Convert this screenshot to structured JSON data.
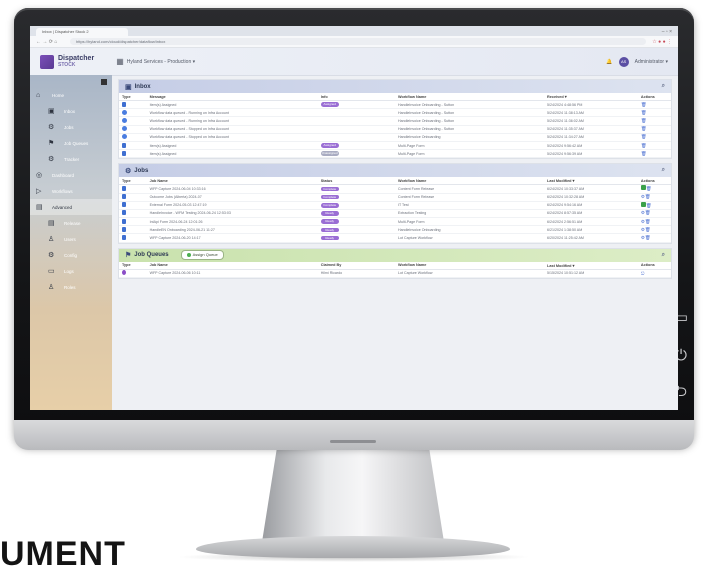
{
  "browser": {
    "tab_title": "Inbox | Dispatcher Stock 2",
    "url": "https://hyland.com/cloud/dispatcher/dataflow/inbox",
    "nav_icons": "← → ⟳ ⌂",
    "ext_icons": "☆ ● ● ⋮",
    "window_controls": "–  ▫  ×"
  },
  "header": {
    "logo_title": "Dispatcher",
    "logo_sub": "STOCK",
    "workspace": "Hyland Services - Production ▾",
    "avatar_initials": "AS",
    "user_name": "Administrator ▾",
    "notif_icon": "🔔"
  },
  "sidebar": {
    "items": [
      {
        "icon": "⌂",
        "label": "Home",
        "sub": false,
        "active": false
      },
      {
        "icon": "▣",
        "label": "Inbox",
        "sub": true,
        "active": false
      },
      {
        "icon": "⚙",
        "label": "Jobs",
        "sub": true,
        "active": false
      },
      {
        "icon": "⚑",
        "label": "Job Queues",
        "sub": true,
        "active": false
      },
      {
        "icon": "⚙",
        "label": "Tracker",
        "sub": true,
        "active": false
      },
      {
        "icon": "◎",
        "label": "Dashboard",
        "sub": false,
        "active": false
      },
      {
        "icon": "▷",
        "label": "Workflows",
        "sub": false,
        "active": false
      },
      {
        "icon": "▤",
        "label": "Advanced",
        "sub": false,
        "active": true
      },
      {
        "icon": "▤",
        "label": "Release",
        "sub": true,
        "active": false
      },
      {
        "icon": "♙",
        "label": "Users",
        "sub": true,
        "active": false
      },
      {
        "icon": "⚙",
        "label": "Config",
        "sub": true,
        "active": false
      },
      {
        "icon": "▭",
        "label": "Logs",
        "sub": true,
        "active": false
      },
      {
        "icon": "♙",
        "label": "Roles",
        "sub": true,
        "active": false
      }
    ]
  },
  "inbox": {
    "title": "Inbox",
    "columns": [
      "Type",
      "Message",
      "Info",
      "Workflow Name",
      "Received ▾",
      "Actions"
    ],
    "rows": [
      {
        "type": "doc",
        "message": "Item(s) Assigned",
        "info": "Assigned",
        "workflow": "HandleInvoice Onboarding - Sutton",
        "received": "5/24/2024 4:48:56 PM"
      },
      {
        "type": "flow",
        "message": "Workflow data queued - Running on Infra Account",
        "info": "",
        "workflow": "HandleInvoice Onboarding - Sutton",
        "received": "5/24/2024 11:38:13 AM"
      },
      {
        "type": "flow",
        "message": "Workflow data queued - Running on Infra Account",
        "info": "",
        "workflow": "HandleInvoice Onboarding - Sutton",
        "received": "5/24/2024 11:36:02 AM"
      },
      {
        "type": "flow",
        "message": "Workflow data queued - Stopped on Infra Account",
        "info": "",
        "workflow": "HandleInvoice Onboarding - Sutton",
        "received": "5/24/2024 11:35:37 AM"
      },
      {
        "type": "flow",
        "message": "Workflow data queued - Stopped on Infra Account",
        "info": "",
        "workflow": "HandleInvoice Onboarding",
        "received": "5/24/2024 11:34:27 AM"
      },
      {
        "type": "doc",
        "message": "Item(s) Assigned",
        "info": "Assigned",
        "workflow": "Multi-Page Form",
        "received": "5/24/2024 9:56:42 AM"
      },
      {
        "type": "doc",
        "message": "Item(s) Assigned",
        "info": "Unassigned",
        "workflow": "Multi-Page Form",
        "received": "5/24/2024 9:56:39 AM"
      }
    ]
  },
  "jobs": {
    "title": "Jobs",
    "columns": [
      "Type",
      "Job Name",
      "Status",
      "Workflow Name",
      "Last Modified ▾",
      "Actions"
    ],
    "rows": [
      {
        "name": "WFP Capture 2024-06-04 10:33:16",
        "status": "Complete",
        "workflow": "Content Form Release",
        "modified": "6/24/2024 10:33:37 AM"
      },
      {
        "name": "Outcome Jobs (Alberta) 2024-07",
        "status": "Complete",
        "workflow": "Content Form Release",
        "modified": "6/24/2024 10:32:28 AM"
      },
      {
        "name": "External Form 2024-05-03 12:47:19",
        "status": "Complete",
        "workflow": "IT Test",
        "modified": "6/24/2024 9:54:16 AM"
      },
      {
        "name": "HandleInvoice - WFM Testing 2024-06-24 12:53:03",
        "status": "Ready",
        "workflow": "Extraction Testing",
        "modified": "6/24/2024 8:57:35 AM"
      },
      {
        "name": "IntApi Form 2024-06-24 12:01:26",
        "status": "Ready",
        "workflow": "Multi-Page Form",
        "modified": "6/24/2024 2:56:51 AM"
      },
      {
        "name": "HandleEN Onboarding 2024-06-21 11:27",
        "status": "Ready",
        "workflow": "HandleInvoice Onboarding",
        "modified": "6/21/2024 1:38:50 AM"
      },
      {
        "name": "WFP Capture 2024-06-20 14:17",
        "status": "Ready",
        "workflow": "Lot Capture Workflow",
        "modified": "6/20/2024 11:25:42 AM"
      }
    ]
  },
  "queues": {
    "title": "Job Queues",
    "button": "Assign Queue",
    "columns": [
      "Type",
      "Job Name",
      "Claimed By",
      "Workflow Name",
      "Last Modified ▾",
      "Actions"
    ],
    "rows": [
      {
        "name": "WFP Capture 2024-06-06 10:11",
        "claimed": "Hilmi Ricardo",
        "workflow": "Lot Capture Workflow",
        "modified": "5/15/2024 10:51:12 AM"
      }
    ]
  },
  "frame": {
    "side_buttons": [
      "▭",
      "⏻",
      "⮌"
    ],
    "bottom_text": "UMENT"
  },
  "colors": {
    "accent": "#5b4fa3",
    "badge": "#9a6ed4",
    "jobs_header": "#c5cde6",
    "queues_header": "#c9e2ad"
  }
}
